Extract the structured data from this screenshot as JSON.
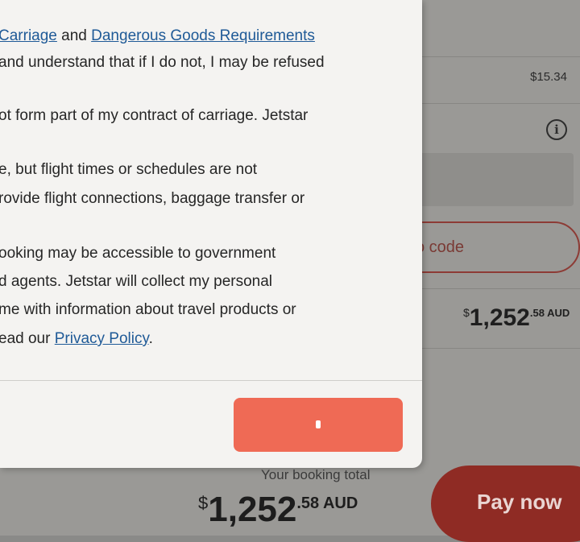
{
  "terms": {
    "line1_link1": "Carriage",
    "line1_and": " and ",
    "line1_link2": "Dangerous Goods Requirements",
    "line2": "and understand that if I do not, I may be refused",
    "line3": "ot form part of my contract of carriage. Jetstar",
    "line4": "e, but flight times or schedules are not",
    "line5": "rovide flight connections, baggage transfer or",
    "line6": "ooking may be accessible to government",
    "line7": "d agents. Jetstar will collect my personal",
    "line8": "me with information about travel products or",
    "line9_prefix": "ead our ",
    "line9_link": "Privacy Policy",
    "line9_suffix": "."
  },
  "background": {
    "fee_price": "$15.34",
    "info_icon": "info-icon",
    "promo_placeholder": "o code",
    "total_symbol": "$",
    "total_main": "1,252",
    "total_cents": ".58",
    "total_currency": " AUD"
  },
  "footer": {
    "booking_total_label": "Your booking total",
    "total_symbol": "$",
    "total_main": "1,252",
    "total_cents": ".58",
    "total_currency": " AUD",
    "pay_label": "Pay now"
  },
  "colors": {
    "accent": "#ef6a55",
    "pay_button": "#8f2b24",
    "link": "#1f5a97"
  }
}
